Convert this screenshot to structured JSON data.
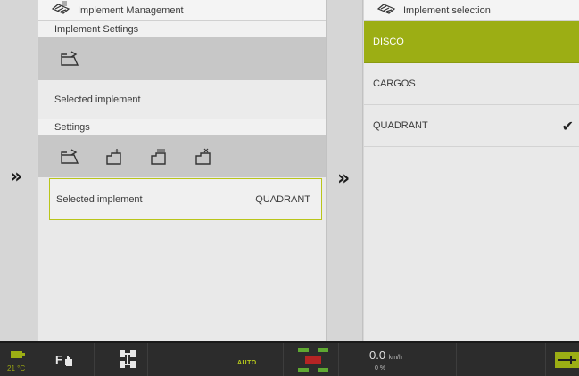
{
  "left_panel": {
    "title": "Implement Management",
    "section_implement_settings": "Implement Settings",
    "selected_implement_label_top": "Selected implement",
    "section_settings": "Settings",
    "selected_row": {
      "label": "Selected implement",
      "value": "QUADRANT"
    }
  },
  "right_panel": {
    "title": "Implement selection",
    "items": [
      {
        "label": "DISCO",
        "state": "highlighted"
      },
      {
        "label": "CARGOS",
        "state": "normal"
      },
      {
        "label": "QUADRANT",
        "state": "checked"
      }
    ]
  },
  "gutter": {
    "chevron": "»"
  },
  "status_bar": {
    "temperature": "21 °C",
    "auto_label": "AUTO",
    "speed_value": "0.0",
    "speed_unit": "km/h",
    "slip": "0 %"
  },
  "colors": {
    "accent": "#9cae14",
    "border_accent": "#b9c51a",
    "bar": "#2c2c2c"
  },
  "icons": [
    "implement-icon",
    "implement-edit-icon",
    "implement-add-icon",
    "implement-list-icon",
    "implement-delete-icon",
    "checkmark-icon",
    "double-chevron-icon",
    "battery-icon",
    "hand-pto-icon",
    "axle-icon",
    "hitch-icon"
  ]
}
